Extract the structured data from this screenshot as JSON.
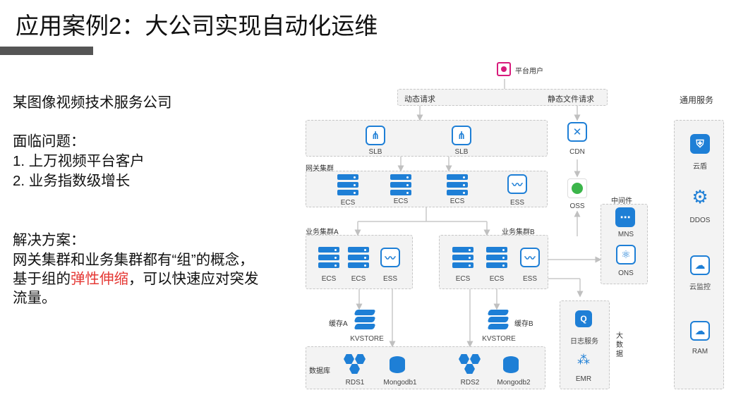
{
  "title": "应用案例2：大公司实现自动化运维",
  "left": {
    "company": "某图像视频技术服务公司",
    "problems_heading": "面临问题：",
    "problem1": "1.  上万视频平台客户",
    "problem2": "2.  业务指数级增长",
    "solution_heading": "解决方案：",
    "solution_line1": "网关集群和业务集群都有“组”的概念，",
    "solution_line2_pre": "基于组的",
    "solution_line2_red": "弹性伸缩",
    "solution_line2_post": "，可以快速应对突发",
    "solution_line3": "流量。"
  },
  "diagram": {
    "platform_user": "平台用户",
    "dynamic_request": "动态请求",
    "static_request": "静态文件请求",
    "slb1": "SLB",
    "slb2": "SLB",
    "cdn": "CDN",
    "gateway_cluster": "网关集群",
    "ecs_g1": "ECS",
    "ecs_g2": "ECS",
    "ecs_g3": "ECS",
    "ess_g": "ESS",
    "oss": "OSS",
    "biz_a": "业务集群A",
    "biz_b": "业务集群B",
    "ecs_a1": "ECS",
    "ecs_a2": "ECS",
    "ess_a": "ESS",
    "ecs_b1": "ECS",
    "ecs_b2": "ECS",
    "ess_b": "ESS",
    "middleware": "中间件",
    "mns": "MNS",
    "ons": "ONS",
    "cache_a": "缓存A",
    "cache_b": "缓存B",
    "kvstore_a": "KVSTORE",
    "kvstore_b": "KVSTORE",
    "database": "数据库",
    "rds1": "RDS1",
    "mongodb1": "Mongodb1",
    "rds2": "RDS2",
    "mongodb2": "Mongodb2",
    "log_service": "日志服务",
    "emr": "EMR",
    "big_data": "大数据"
  },
  "common": {
    "title": "通用服务",
    "shield": "云盾",
    "ddos": "DDOS",
    "monitor": "云监控",
    "ram": "RAM"
  },
  "colors": {
    "accent": "#1e7fd6",
    "magenta": "#d81b7c",
    "red": "#e53935",
    "green": "#3bb54a"
  }
}
